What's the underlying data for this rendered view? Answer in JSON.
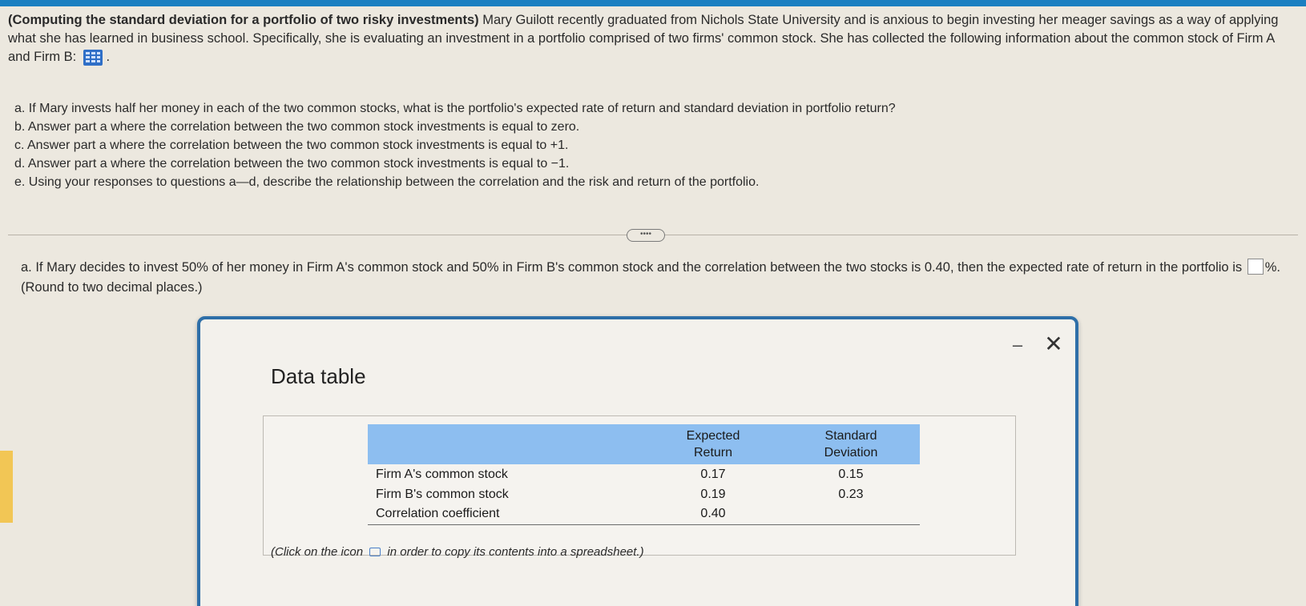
{
  "problem": {
    "title": "(Computing the standard deviation for a portfolio of two risky investments)",
    "intro": "Mary Guilott recently graduated from Nichols State University and is anxious to begin investing her meager savings as a way of applying what she has learned in business school. Specifically, she is evaluating an investment in a portfolio comprised of two firms' common stock. She has collected the following information about the common stock of Firm A and Firm B:",
    "intro_end": ".",
    "data_icon": "table-grid-icon"
  },
  "questions": [
    "a. If Mary invests half her money in each of the two common stocks, what is the portfolio's expected rate of return and standard deviation in portfolio return?",
    "b. Answer part a where the correlation between the two common stock investments is equal to zero.",
    "c. Answer part a where the correlation between the two common stock investments is equal to +1.",
    "d. Answer part a where the correlation between the two common stock investments is equal to −1.",
    "e. Using your responses to questions a—d, describe the relationship between the correlation and the risk and return of the portfolio."
  ],
  "divider_handle": "••••",
  "answer": {
    "text_before": "a. If Mary decides to invest 50% of her money in Firm A's common stock and 50% in Firm B's common stock and the correlation between the two stocks is 0.40, then the expected rate of return in the portfolio is",
    "value": "",
    "text_after": "%.",
    "hint": "(Round to two decimal places.)"
  },
  "modal": {
    "title": "Data table",
    "minimize": "–",
    "close": "✕",
    "table": {
      "headers": [
        "",
        "Expected\nReturn",
        "Standard\nDeviation"
      ],
      "rows": [
        [
          "Firm A's common stock",
          "0.17",
          "0.15"
        ],
        [
          "Firm B's common stock",
          "0.19",
          "0.23"
        ],
        [
          "Correlation coefficient",
          "0.40",
          ""
        ]
      ]
    },
    "copy_note_before": "(Click on the icon",
    "copy_note_after": "in order to copy its contents into a spreadsheet.)",
    "copy_icon": "copy-icon"
  },
  "colors": {
    "accent_bar": "#1b7fc1",
    "modal_border": "#2e6fa8",
    "table_header": "#8dbef0",
    "left_accent": "#f2c655"
  }
}
